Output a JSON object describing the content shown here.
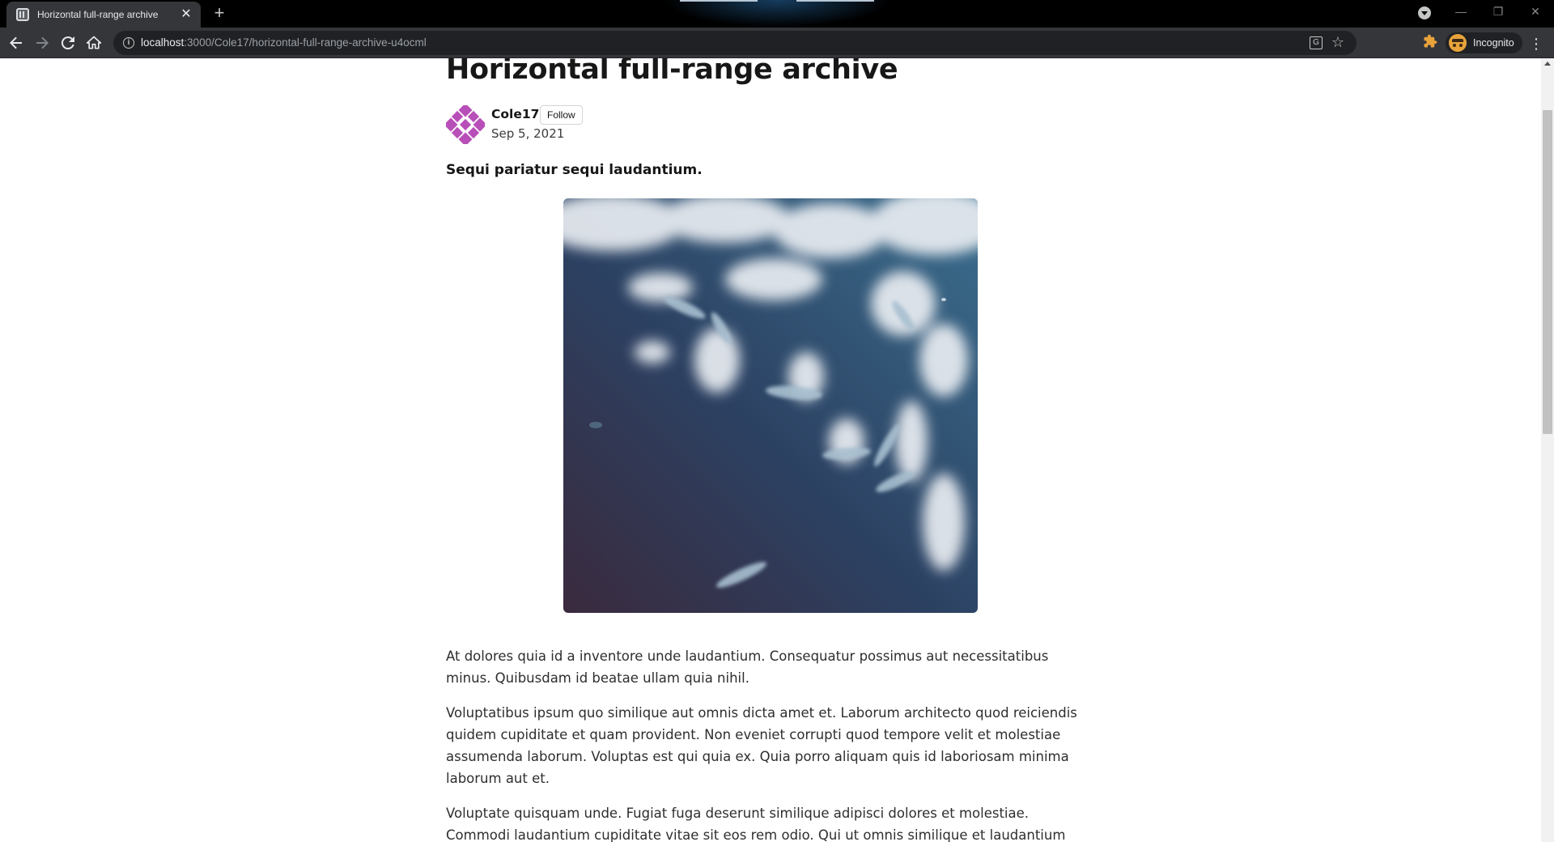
{
  "browser": {
    "tab_title": "Horizontal full-range archive",
    "tab_close": "✕",
    "new_tab": "+",
    "url_host": "localhost",
    "url_path": ":3000/Cole17/horizontal-full-range-archive-u4ocml",
    "profile_label": "Incognito",
    "window_controls": {
      "minimize": "—",
      "restore": "❐",
      "close": "✕"
    },
    "icons": [
      "back-icon",
      "forward-icon",
      "reload-icon",
      "home-icon",
      "site-info-icon",
      "translate-icon",
      "bookmark-star-icon",
      "extensions-icon",
      "incognito-icon",
      "menu-icon",
      "tab-search-icon"
    ]
  },
  "article": {
    "title": "Horizontal full-range archive",
    "author": "Cole17",
    "follow_label": "Follow",
    "date": "Sep 5, 2021",
    "subtitle": "Sequi pariatur sequi laudantium.",
    "paragraphs": [
      "At dolores quia id a inventore unde laudantium. Consequatur possimus aut necessitatibus minus. Quibusdam id beatae ullam quia nihil.",
      "Voluptatibus ipsum quo similique aut omnis dicta amet et. Laborum architecto quod reiciendis quidem cupiditate et quam provident. Non eveniet corrupti quod tempore velit et molestiae assumenda laborum. Voluptas est qui quia ex. Quia porro aliquam quis id laboriosam minima laborum aut et.",
      "Voluptate quisquam unde. Fugiat fuga deserunt similique adipisci dolores et molestiae. Commodi laudantium cupiditate vitae sit eos rem odio. Qui ut omnis similique et laudantium quo. Molestias"
    ]
  },
  "colors": {
    "chrome_dark": "#35363a",
    "omnibox": "#202124",
    "avatar_purple": "#b84fb8",
    "water_deep": "#3a2a3e",
    "water_blue": "#2f5a7a"
  }
}
